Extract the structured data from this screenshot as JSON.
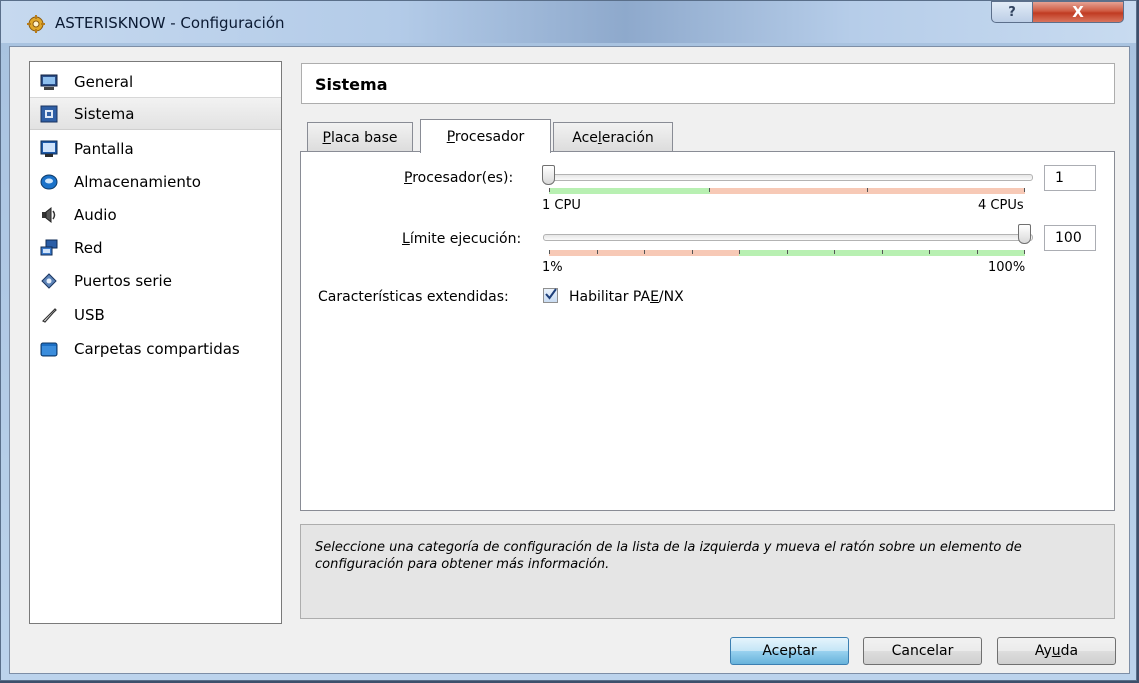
{
  "window": {
    "title": "ASTERISKNOW - Configuración",
    "help_button": "?",
    "close_button": "X"
  },
  "sidebar": {
    "items": [
      {
        "label": "General",
        "icon": "monitor-icon"
      },
      {
        "label": "Sistema",
        "icon": "chip-icon",
        "selected": true
      },
      {
        "label": "Pantalla",
        "icon": "display-icon"
      },
      {
        "label": "Almacenamiento",
        "icon": "disk-icon"
      },
      {
        "label": "Audio",
        "icon": "speaker-icon"
      },
      {
        "label": "Red",
        "icon": "network-icon"
      },
      {
        "label": "Puertos serie",
        "icon": "serial-port-icon"
      },
      {
        "label": "USB",
        "icon": "usb-icon"
      },
      {
        "label": "Carpetas compartidas",
        "icon": "folder-icon"
      }
    ]
  },
  "section": {
    "title": "Sistema"
  },
  "tabs": [
    {
      "label": "Placa base",
      "underline": "P",
      "rest": "laca base"
    },
    {
      "label": "Procesador",
      "underline": "P",
      "rest": "rocesador",
      "active": true
    },
    {
      "label": "Aceleración",
      "pre": "Ace",
      "underline": "l",
      "rest": "eración"
    }
  ],
  "processor": {
    "cpu_label_u": "P",
    "cpu_label_rest": "rocesador(es):",
    "cpu_value": "1",
    "cpu_min_label": "1 CPU",
    "cpu_max_label": "4 CPUs",
    "cpu_level": 1,
    "cpu_max": 4,
    "cap_label_u": "L",
    "cap_label_rest": "ímite ejecución:",
    "cap_value": "100",
    "cap_min_label": "1%",
    "cap_max_label": "100%",
    "cap_level_percent": 100,
    "ext_label": "Características extendidas:",
    "pae_pre": "Habilitar PA",
    "pae_u": "E",
    "pae_rest": "/NX",
    "pae_checked": true
  },
  "info": {
    "text": "Seleccione una categoría de configuración de la lista de la izquierda y mueva el ratón sobre un elemento de configuración para obtener más información."
  },
  "buttons": {
    "ok": "Aceptar",
    "cancel": "Cancelar",
    "help_pre": "Ay",
    "help_u": "u",
    "help_rest": "da"
  },
  "colors": {
    "ok_range": "#b8f0b2",
    "warn_range": "#f7c9b6",
    "selection": "#e6e6e6"
  }
}
